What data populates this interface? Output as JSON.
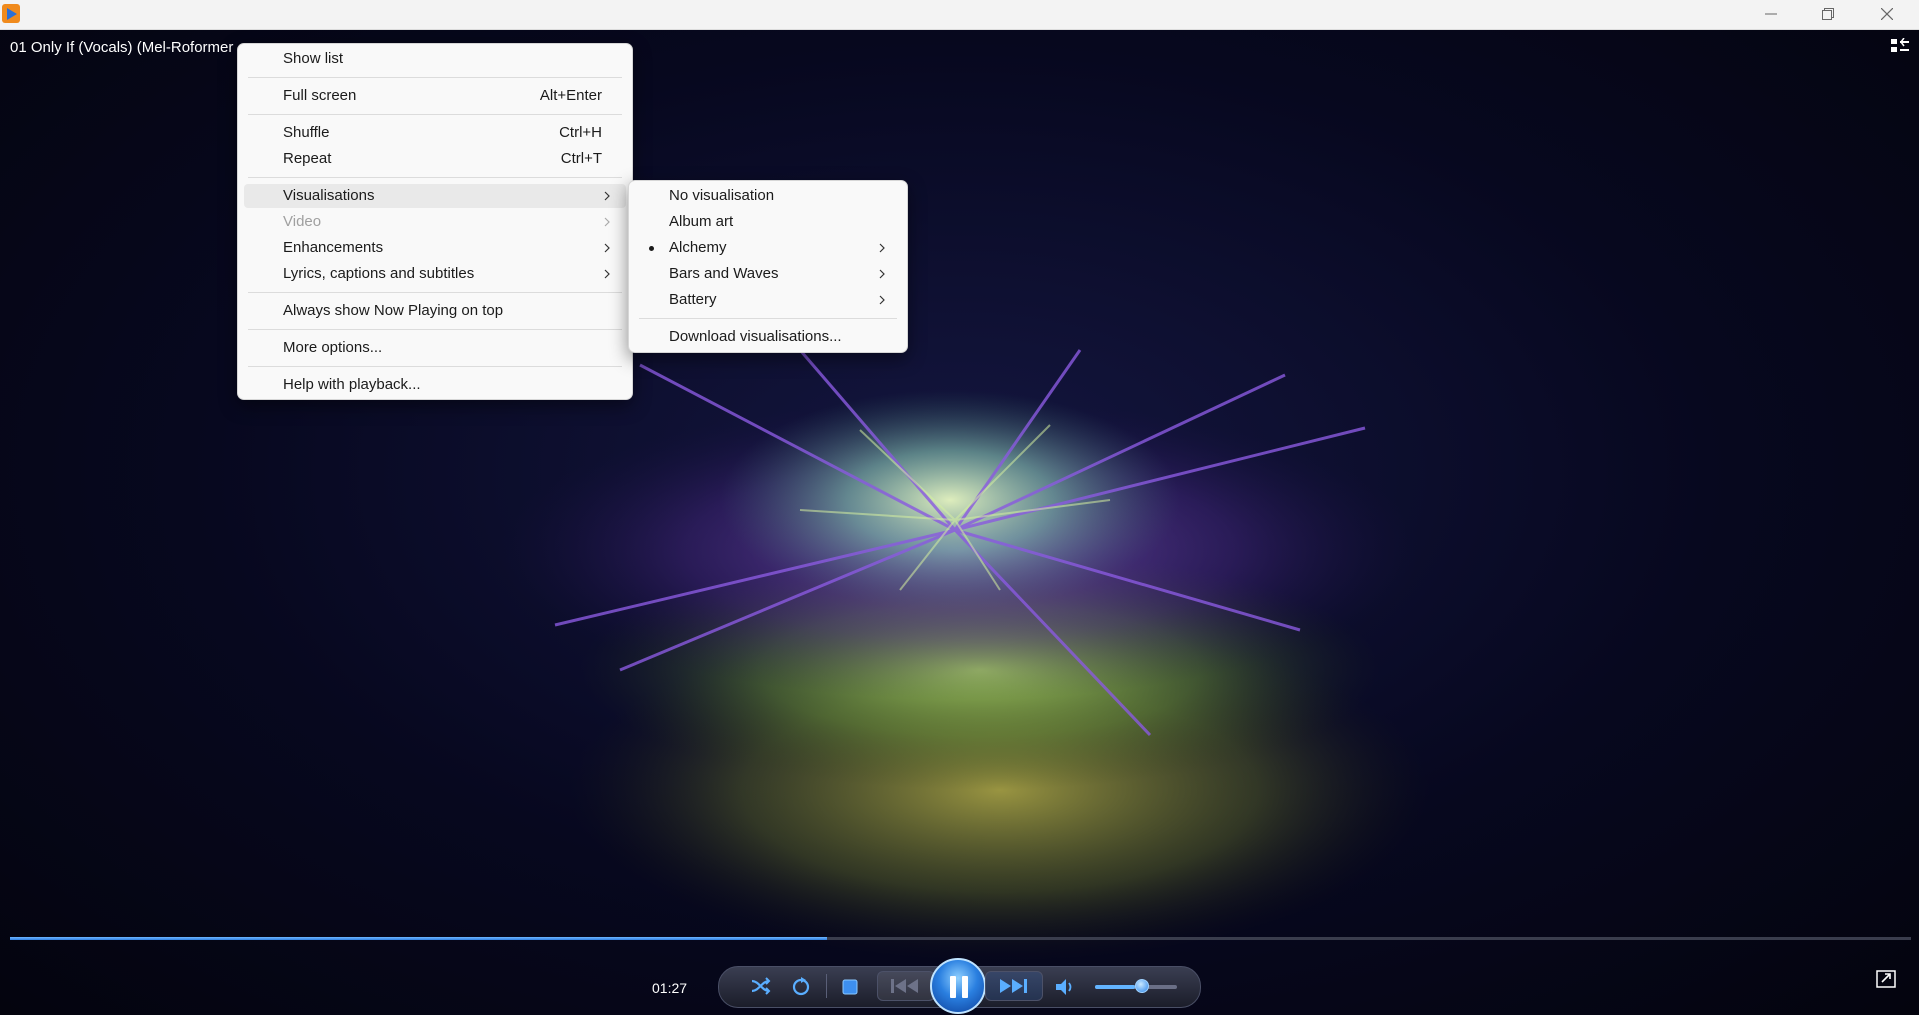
{
  "window": {
    "track_title": "01 Only If (Vocals) (Mel-Roformer",
    "time_elapsed": "01:27",
    "progress_fraction": 0.43,
    "volume_fraction": 0.49
  },
  "main_menu": {
    "show_list": "Show list",
    "full_screen": "Full screen",
    "full_screen_shortcut": "Alt+Enter",
    "shuffle": "Shuffle",
    "shuffle_shortcut": "Ctrl+H",
    "repeat": "Repeat",
    "repeat_shortcut": "Ctrl+T",
    "visualisations": "Visualisations",
    "video": "Video",
    "enhancements": "Enhancements",
    "lyrics": "Lyrics, captions and subtitles",
    "always_on_top": "Always show Now Playing on top",
    "more_options": "More options...",
    "help": "Help with playback..."
  },
  "visualisations_menu": {
    "none": "No visualisation",
    "album_art": "Album art",
    "alchemy": "Alchemy",
    "bars_waves": "Bars and Waves",
    "battery": "Battery",
    "download": "Download visualisations...",
    "selected": "Alchemy"
  },
  "colors": {
    "accent": "#2f7fe0",
    "menu_bg": "#f9f9f9",
    "menu_highlight": "#e9e9e9"
  }
}
